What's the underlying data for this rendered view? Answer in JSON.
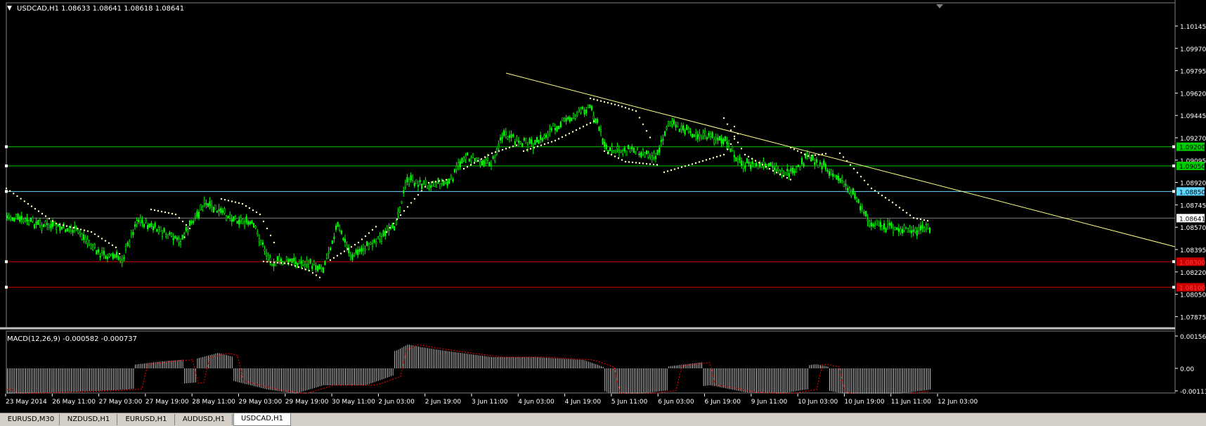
{
  "main_chart": {
    "symbol_header": "USDCAD,H1  1.08633 1.08641 1.08618 1.08641",
    "price_ticks": [
      "1.10145",
      "1.09970",
      "1.09795",
      "1.09620",
      "1.09445",
      "1.09270",
      "1.09095",
      "1.08920",
      "1.08745",
      "1.08570",
      "1.08395",
      "1.08220",
      "1.08050",
      "1.07875"
    ],
    "current_price": "1.08641",
    "levels": [
      {
        "label": "1.09200",
        "color": "#00cc00",
        "text_color": "#000000"
      },
      {
        "label": "1.09050",
        "color": "#00cc00",
        "text_color": "#000000"
      },
      {
        "label": "1.08850",
        "color": "#5fd7ff",
        "text_color": "#000000"
      },
      {
        "label": "1.08300",
        "color": "#cc0000",
        "text_color": "#ff4040"
      },
      {
        "label": "1.08100",
        "color": "#cc0000",
        "text_color": "#ff4040"
      }
    ],
    "colors": {
      "candles": "#00ff00",
      "sar": "#ffffc0",
      "trendline": "#ffff80",
      "grid": "#808080"
    }
  },
  "macd_panel": {
    "header": "MACD(12,26,9) -0.000582 -0.000737",
    "ticks": [
      "0.001562",
      "0.00",
      "-0.001137"
    ],
    "colors": {
      "histogram": "#c0c0c0",
      "signal": "#ff0000"
    }
  },
  "time_axis": [
    "23 May 2014",
    "26 May 11:00",
    "27 May 03:00",
    "27 May 19:00",
    "28 May 11:00",
    "29 May 03:00",
    "29 May 19:00",
    "30 May 11:00",
    "2 Jun 03:00",
    "2 Jun 19:00",
    "3 Jun 11:00",
    "4 Jun 03:00",
    "4 Jun 19:00",
    "5 Jun 11:00",
    "6 Jun 03:00",
    "6 Jun 19:00",
    "9 Jun 11:00",
    "10 Jun 03:00",
    "10 Jun 19:00",
    "11 Jun 11:00",
    "12 Jun 03:00"
  ],
  "tabs": [
    {
      "label": "EURUSD,M30",
      "active": false
    },
    {
      "label": "NZDUSD,H1",
      "active": false
    },
    {
      "label": "EURUSD,H1",
      "active": false
    },
    {
      "label": "AUDUSD,H1",
      "active": false
    },
    {
      "label": "USDCAD,H1",
      "active": true
    }
  ]
}
